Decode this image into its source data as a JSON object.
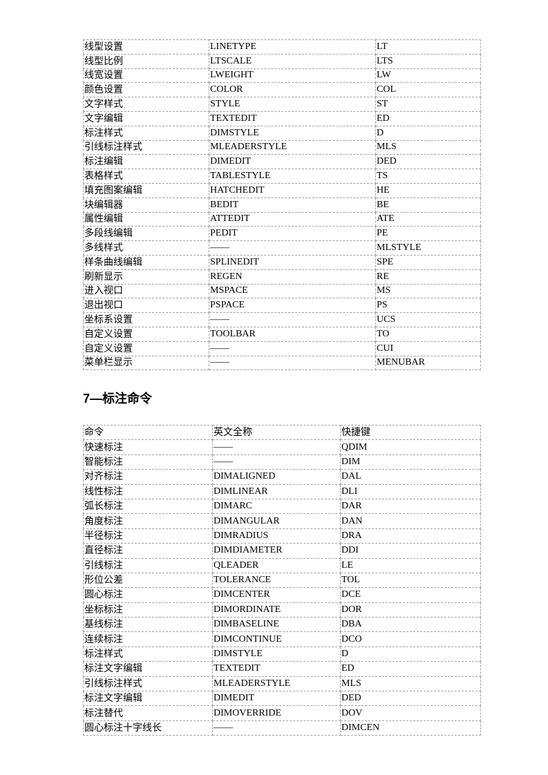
{
  "table1": {
    "rows": [
      [
        "线型设置",
        "LINETYPE",
        "LT"
      ],
      [
        "线型比例",
        "LTSCALE",
        "LTS"
      ],
      [
        "线宽设置",
        "LWEIGHT",
        "LW"
      ],
      [
        "颜色设置",
        "COLOR",
        "COL"
      ],
      [
        "文字样式",
        "STYLE",
        "ST"
      ],
      [
        "文字编辑",
        "TEXTEDIT",
        "ED"
      ],
      [
        "标注样式",
        "DIMSTYLE",
        "D"
      ],
      [
        "引线标注样式",
        "MLEADERSTYLE",
        "MLS"
      ],
      [
        "标注编辑",
        "DIMEDIT",
        "DED"
      ],
      [
        "表格样式",
        "TABLESTYLE",
        "TS"
      ],
      [
        "填充图案编辑",
        "HATCHEDIT",
        "HE"
      ],
      [
        "块编辑器",
        "BEDIT",
        "BE"
      ],
      [
        "属性编辑",
        "ATTEDIT",
        "ATE"
      ],
      [
        "多段线编辑",
        "PEDIT",
        "PE"
      ],
      [
        "多线样式",
        "——",
        "MLSTYLE"
      ],
      [
        "样条曲线编辑",
        "SPLINEDIT",
        "SPE"
      ],
      [
        "刷新显示",
        "REGEN",
        "RE"
      ],
      [
        "进入视口",
        "MSPACE",
        "MS"
      ],
      [
        "退出视口",
        "PSPACE",
        "PS"
      ],
      [
        "坐标系设置",
        "——",
        "UCS"
      ],
      [
        "自定义设置",
        "TOOLBAR",
        "TO"
      ],
      [
        "自定义设置",
        "——",
        "CUI"
      ],
      [
        "菜单栏显示",
        "——",
        "MENUBAR"
      ]
    ]
  },
  "section_heading": "7—标注命令",
  "table2": {
    "header": [
      "命令",
      "英文全称",
      "快捷键"
    ],
    "rows": [
      [
        "快速标注",
        "——",
        "QDIM"
      ],
      [
        "智能标注",
        "——",
        "DIM"
      ],
      [
        "对齐标注",
        "DIMALIGNED",
        "DAL"
      ],
      [
        "线性标注",
        "DIMLINEAR",
        "DLI"
      ],
      [
        "弧长标注",
        "DIMARC",
        "DAR"
      ],
      [
        "角度标注",
        "DIMANGULAR",
        "DAN"
      ],
      [
        "半径标注",
        "DIMRADIUS",
        "DRA"
      ],
      [
        "直径标注",
        "DIMDIAMETER",
        "DDI"
      ],
      [
        "引线标注",
        "QLEADER",
        "LE"
      ],
      [
        "形位公差",
        "TOLERANCE",
        "TOL"
      ],
      [
        "圆心标注",
        "DIMCENTER",
        "DCE"
      ],
      [
        "坐标标注",
        "DIMORDINATE",
        "DOR"
      ],
      [
        "基线标注",
        "DIMBASELINE",
        "DBA"
      ],
      [
        "连续标注",
        "DIMCONTINUE",
        "DCO"
      ],
      [
        "标注样式",
        "DIMSTYLE",
        "D"
      ],
      [
        "标注文字编辑",
        "TEXTEDIT",
        "ED"
      ],
      [
        "引线标注样式",
        "MLEADERSTYLE",
        "MLS"
      ],
      [
        "标注文字编辑",
        "DIMEDIT",
        "DED"
      ],
      [
        "标注替代",
        "DIMOVERRIDE",
        "DOV"
      ],
      [
        "圆心标注十字线长",
        "——",
        "DIMCEN"
      ]
    ]
  }
}
